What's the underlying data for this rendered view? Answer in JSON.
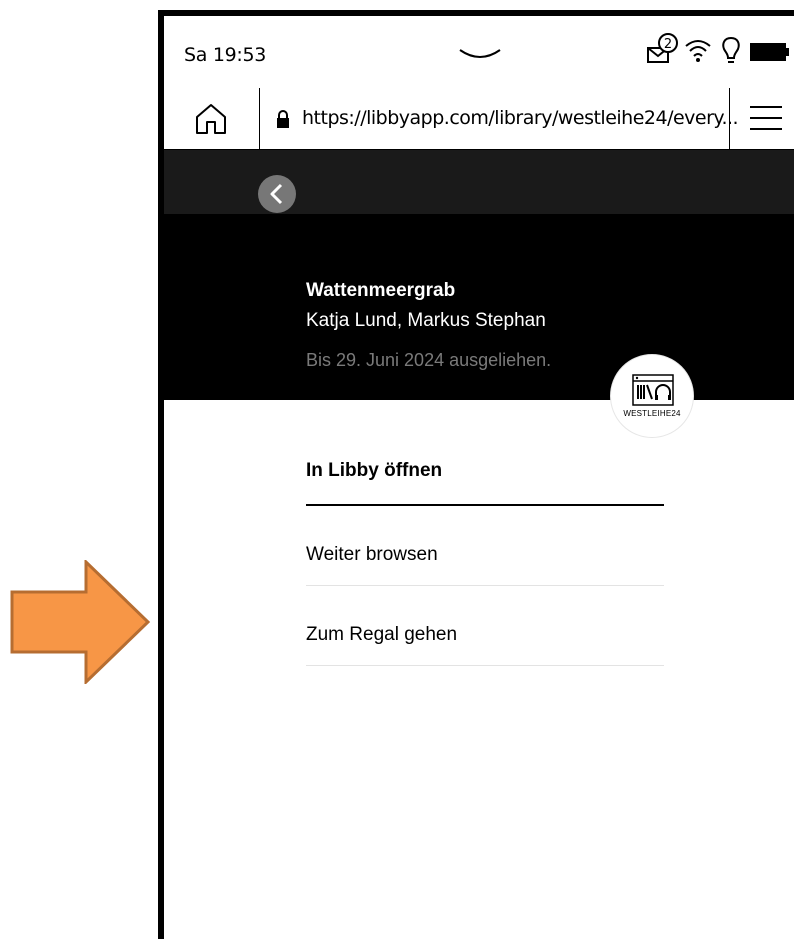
{
  "status_bar": {
    "time": "Sa 19:53",
    "notification_count": "2"
  },
  "address_bar": {
    "url": "https://libbyapp.com/library/westleihe24/every..."
  },
  "loan": {
    "title": "Wattenmeergrab",
    "authors": "Katja Lund, Markus Stephan",
    "due_text": "Bis 29. Juni 2024 ausgeliehen."
  },
  "library": {
    "badge_label": "WESTLEIHE24"
  },
  "actions": [
    {
      "label": "In Libby öffnen"
    },
    {
      "label": "Weiter browsen"
    },
    {
      "label": "Zum Regal gehen"
    }
  ],
  "colors": {
    "arrow_fill": "#F79646",
    "arrow_stroke": "#B66D31",
    "header_bg": "#000000",
    "loan_text": "#7A7A7A"
  }
}
